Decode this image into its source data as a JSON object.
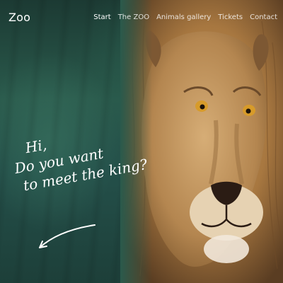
{
  "brand": {
    "name": "Zoo"
  },
  "nav": {
    "items": [
      {
        "label": "Start",
        "active": true
      },
      {
        "label": "The ZOO",
        "active": false
      },
      {
        "label": "Animals gallery",
        "active": false
      },
      {
        "label": "Tickets",
        "active": false
      },
      {
        "label": "Contact",
        "active": false
      }
    ]
  },
  "hero": {
    "tagline": {
      "line1": "Hi,",
      "line2": "Do you want",
      "line3": "to meet the king?"
    },
    "image": "lion-photo"
  },
  "colors": {
    "background_green": "#2a5a4c",
    "text": "#ffffff"
  }
}
